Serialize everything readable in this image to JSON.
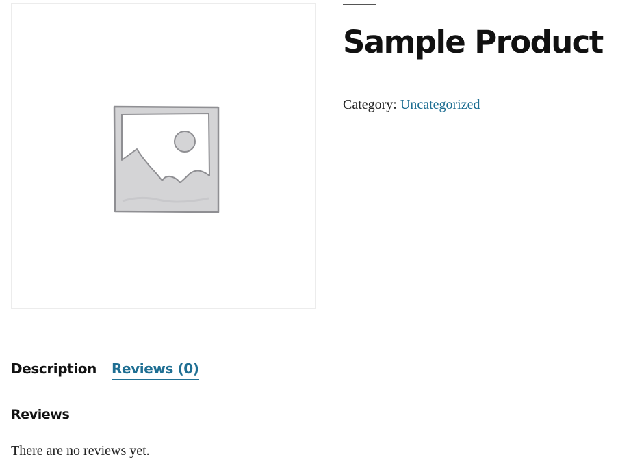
{
  "product": {
    "title": "Sample Product",
    "category_label": "Category:",
    "category_value": "Uncategorized",
    "image_icon": "image-placeholder-icon"
  },
  "tabs": [
    {
      "label": "Description",
      "active": false
    },
    {
      "label": "Reviews (0)",
      "active": true
    }
  ],
  "reviews": {
    "heading": "Reviews",
    "empty_text": "There are no reviews yet."
  },
  "colors": {
    "text": "#111111",
    "link": "#1f6f93",
    "placeholder_fill": "#d4d4d6",
    "placeholder_stroke": "#8f8f93",
    "gallery_border": "#ececec"
  }
}
